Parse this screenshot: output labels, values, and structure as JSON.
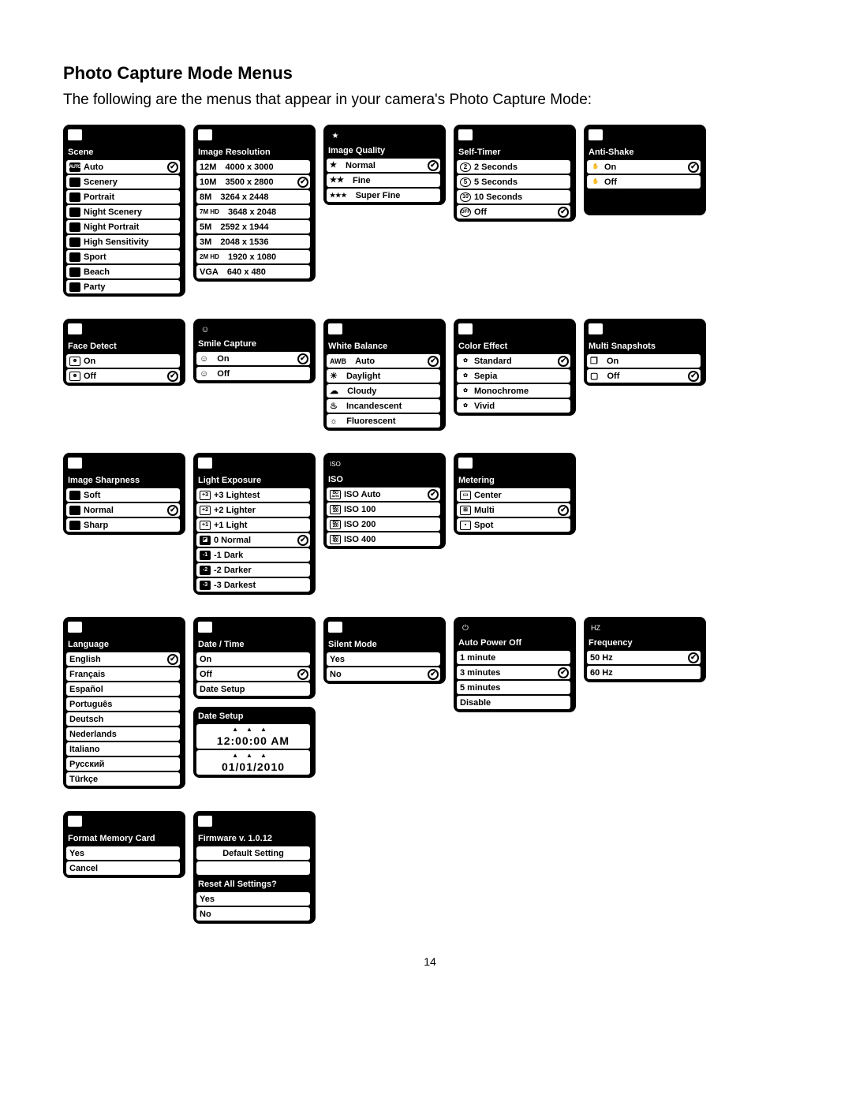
{
  "page": {
    "title": "Photo Capture Mode Menus",
    "intro": "The following are the menus that appear in your camera's Photo Capture Mode:",
    "page_number": "14"
  },
  "menus": {
    "scene": {
      "title": "Scene",
      "items": [
        "Auto",
        "Scenery",
        "Portrait",
        "Night Scenery",
        "Night Portrait",
        "High Sensitivity",
        "Sport",
        "Beach",
        "Party"
      ],
      "selected": 0
    },
    "resolution": {
      "title": "Image Resolution",
      "items": [
        {
          "prefix": "12M",
          "label": "4000 x 3000"
        },
        {
          "prefix": "10M",
          "label": "3500 x 2800"
        },
        {
          "prefix": "8M",
          "label": "3264 x 2448"
        },
        {
          "prefix": "7M HD",
          "label": "3648 x 2048"
        },
        {
          "prefix": "5M",
          "label": "2592 x 1944"
        },
        {
          "prefix": "3M",
          "label": "2048 x 1536"
        },
        {
          "prefix": "2M HD",
          "label": "1920 x 1080"
        },
        {
          "prefix": "VGA",
          "label": "640 x 480"
        }
      ],
      "selected": 1
    },
    "quality": {
      "title": "Image Quality",
      "items": [
        "Normal",
        "Fine",
        "Super Fine"
      ],
      "selected": 0,
      "stars": [
        "★",
        "★★",
        "★★★"
      ]
    },
    "selftimer": {
      "title": "Self-Timer",
      "items": [
        "2 Seconds",
        "5 Seconds",
        "10 Seconds",
        "Off"
      ],
      "selected": 3
    },
    "antishake": {
      "title": "Anti-Shake",
      "items": [
        "On",
        "Off"
      ],
      "selected": 0
    },
    "facedetect": {
      "title": "Face Detect",
      "items": [
        "On",
        "Off"
      ],
      "selected": 1
    },
    "smile": {
      "title": "Smile Capture",
      "items": [
        "On",
        "Off"
      ],
      "selected": 0
    },
    "wb": {
      "title": "White Balance",
      "items": [
        "Auto",
        "Daylight",
        "Cloudy",
        "Incandescent",
        "Fluorescent"
      ],
      "selected": 0,
      "prefix0": "AWB"
    },
    "color": {
      "title": "Color Effect",
      "items": [
        "Standard",
        "Sepia",
        "Monochrome",
        "Vivid"
      ],
      "selected": 0
    },
    "multi": {
      "title": "Multi Snapshots",
      "items": [
        "On",
        "Off"
      ],
      "selected": 1
    },
    "sharpness": {
      "title": "Image Sharpness",
      "items": [
        "Soft",
        "Normal",
        "Sharp"
      ],
      "selected": 1
    },
    "exposure": {
      "title": "Light Exposure",
      "items": [
        "+3 Lightest",
        "+2 Lighter",
        "+1 Light",
        "0 Normal",
        "-1 Dark",
        "-2 Darker",
        "-3 Darkest"
      ],
      "selected": 3
    },
    "iso": {
      "title": "ISO",
      "items": [
        "ISO Auto",
        "ISO 100",
        "ISO 200",
        "ISO 400"
      ],
      "selected": 0
    },
    "metering": {
      "title": "Metering",
      "items": [
        "Center",
        "Multi",
        "Spot"
      ],
      "selected": 1
    },
    "language": {
      "title": "Language",
      "items": [
        "English",
        "Français",
        "Español",
        "Português",
        "Deutsch",
        "Nederlands",
        "Italiano",
        "Русский",
        "Türkçe"
      ],
      "selected": 0
    },
    "datetime": {
      "title": "Date / Time",
      "items": [
        "On",
        "Off",
        "Date Setup"
      ],
      "selected": 1
    },
    "datesetup": {
      "title": "Date Setup",
      "time": "12:00:00 AM",
      "date": "01/01/2010"
    },
    "silent": {
      "title": "Silent Mode",
      "items": [
        "Yes",
        "No"
      ],
      "selected": 1
    },
    "autopower": {
      "title": "Auto Power Off",
      "items": [
        "1 minute",
        "3 minutes",
        "5 minutes",
        "Disable"
      ],
      "selected": 1
    },
    "frequency": {
      "title": "Frequency",
      "items": [
        "50 Hz",
        "60 Hz"
      ],
      "selected": 0
    },
    "format": {
      "title": "Format Memory Card",
      "items": [
        "Yes",
        "Cancel"
      ]
    },
    "firmware": {
      "title": "Firmware v. 1.0.12",
      "default": "Default Setting",
      "reset_title": "Reset All Settings?",
      "items": [
        "Yes",
        "No"
      ]
    }
  }
}
